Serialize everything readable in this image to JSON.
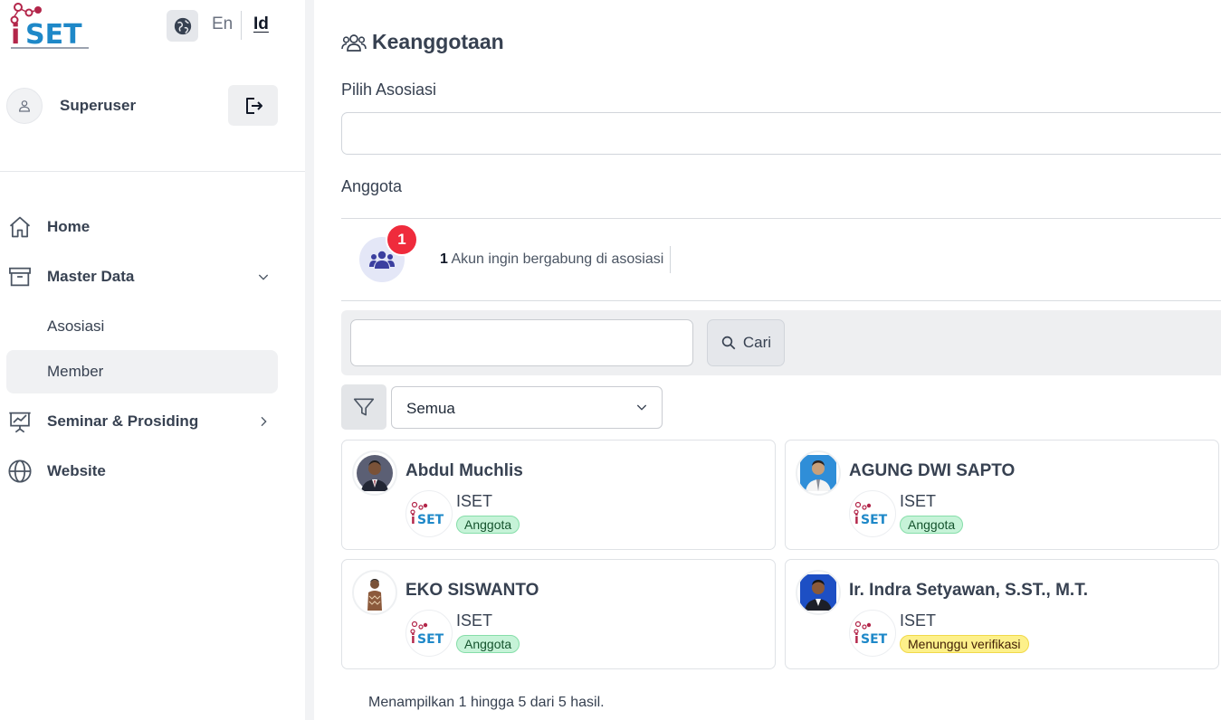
{
  "logo": {
    "text": "iSET",
    "tagline": "INDONESIAN SOCIETY OF ENGINEERING AND TECHNOLOGY"
  },
  "lang": {
    "en": "En",
    "id": "Id",
    "active": "Id"
  },
  "user": {
    "name": "Superuser"
  },
  "nav": {
    "home": "Home",
    "master_data": "Master Data",
    "asosiasi": "Asosiasi",
    "member": "Member",
    "seminar": "Seminar & Prosiding",
    "website": "Website"
  },
  "page": {
    "title": "Keanggotaan",
    "pilih_asosiasi_label": "Pilih Asosiasi",
    "anggota_label": "Anggota"
  },
  "join_request": {
    "count": "1",
    "text": "Akun ingin bergabung di asosiasi",
    "badge": "1"
  },
  "search": {
    "button_label": "Cari",
    "placeholder": ""
  },
  "filter": {
    "selected": "Semua"
  },
  "members": [
    {
      "name": "Abdul Muchlis",
      "org": "ISET",
      "status": "Anggota"
    },
    {
      "name": "AGUNG DWI SAPTO",
      "org": "ISET",
      "status": "Anggota"
    },
    {
      "name": "EKO SISWANTO",
      "org": "ISET",
      "status": "Anggota"
    },
    {
      "name": "Ir. Indra Setyawan, S.ST., M.T.",
      "org": "ISET",
      "status": "Menunggu verifikasi"
    }
  ],
  "summary": "Menampilkan 1 hingga 5 dari 5 hasil.",
  "colors": {
    "brand_red": "#b3264a",
    "brand_blue": "#1e88c8",
    "badge_red": "#ef2b3c",
    "status_green": "#c6f3d8",
    "status_yellow": "#fdf08a"
  }
}
